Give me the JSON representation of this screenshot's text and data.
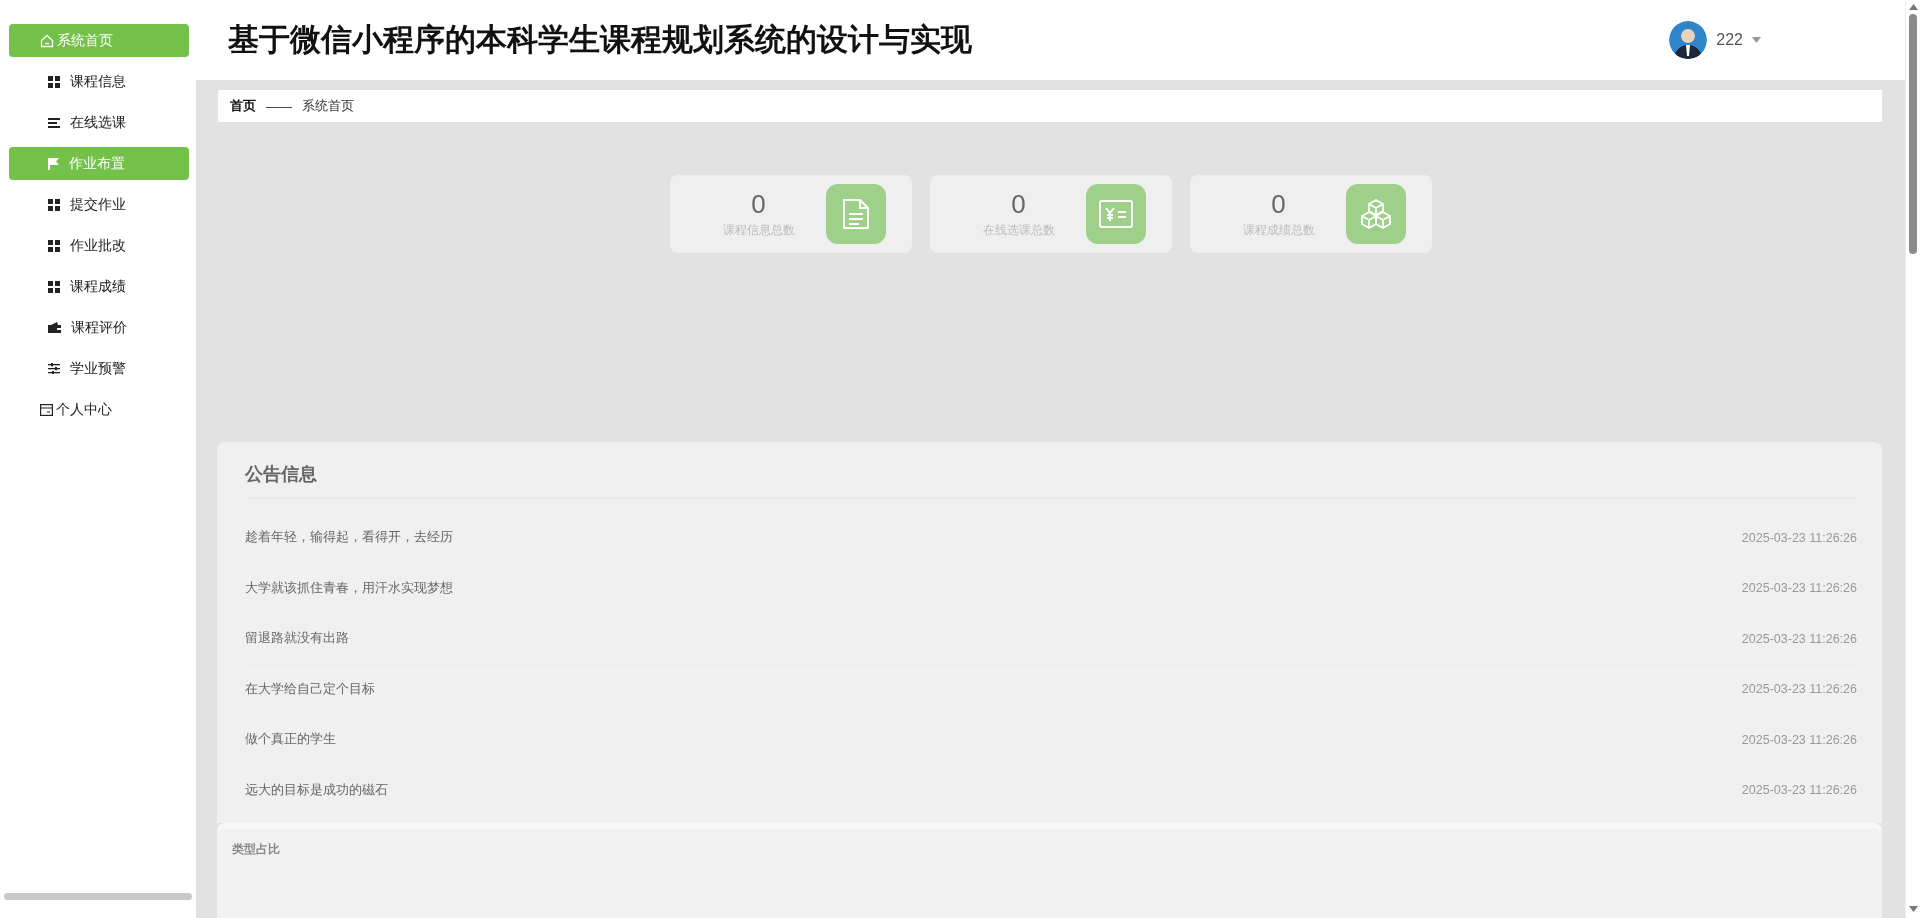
{
  "sidebar": {
    "items": [
      {
        "label": "系统首页",
        "kind": "top",
        "selected": true
      },
      {
        "label": "课程信息",
        "kind": "sub",
        "selected": false
      },
      {
        "label": "在线选课",
        "kind": "sub",
        "selected": false
      },
      {
        "label": "作业布置",
        "kind": "sub",
        "selected": true
      },
      {
        "label": "提交作业",
        "kind": "sub",
        "selected": false
      },
      {
        "label": "作业批改",
        "kind": "sub",
        "selected": false
      },
      {
        "label": "课程成绩",
        "kind": "sub",
        "selected": false
      },
      {
        "label": "课程评价",
        "kind": "sub",
        "selected": false
      },
      {
        "label": "学业预警",
        "kind": "sub",
        "selected": false
      },
      {
        "label": "个人中心",
        "kind": "top",
        "selected": false
      }
    ]
  },
  "header": {
    "title": "基于微信小程序的本科学生课程规划系统的设计与实现",
    "user": {
      "name": "222"
    }
  },
  "breadcrumb": {
    "items": [
      "首页",
      "系统首页"
    ],
    "separator": "——"
  },
  "stats": [
    {
      "value": "0",
      "label": "课程信息总数"
    },
    {
      "value": "0",
      "label": "在线选课总数"
    },
    {
      "value": "0",
      "label": "课程成绩总数"
    }
  ],
  "notices": {
    "title": "公告信息",
    "items": [
      {
        "text": "趁着年轻，输得起，看得开，去经历",
        "date": "2025-03-23 11:26:26"
      },
      {
        "text": "大学就该抓住青春，用汗水实现梦想",
        "date": "2025-03-23 11:26:26"
      },
      {
        "text": "留退路就没有出路",
        "date": "2025-03-23 11:26:26"
      },
      {
        "text": "在大学给自己定个目标",
        "date": "2025-03-23 11:26:26"
      },
      {
        "text": "做个真正的学生",
        "date": "2025-03-23 11:26:26"
      },
      {
        "text": "远大的目标是成功的磁石",
        "date": "2025-03-23 11:26:26"
      }
    ]
  },
  "chart_panel": {
    "title": "类型占比"
  }
}
